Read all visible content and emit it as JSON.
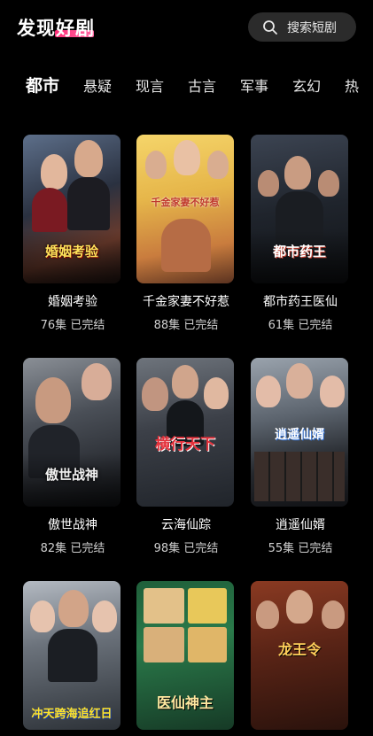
{
  "header": {
    "title": "发现好剧",
    "search_placeholder": "搜索短剧"
  },
  "tabs": [
    {
      "label": "都市",
      "active": true
    },
    {
      "label": "悬疑",
      "active": false
    },
    {
      "label": "现言",
      "active": false
    },
    {
      "label": "古言",
      "active": false
    },
    {
      "label": "军事",
      "active": false
    },
    {
      "label": "玄幻",
      "active": false
    },
    {
      "label": "热",
      "active": false
    }
  ],
  "dramas": [
    {
      "title": "婚姻考验",
      "episodes": "76集",
      "status": "已完结",
      "poster_text": "婚姻考验"
    },
    {
      "title": "千金家妻不好惹",
      "episodes": "88集",
      "status": "已完结",
      "poster_text": "千金家妻不好惹"
    },
    {
      "title": "都市药王医仙",
      "episodes": "61集",
      "status": "已完结",
      "poster_text": "都市药王"
    },
    {
      "title": "傲世战神",
      "episodes": "82集",
      "status": "已完结",
      "poster_text": "傲世战神"
    },
    {
      "title": "云海仙踪",
      "episodes": "98集",
      "status": "已完结",
      "poster_text": "横行天下"
    },
    {
      "title": "逍遥仙婿",
      "episodes": "55集",
      "status": "已完结",
      "poster_text": "逍遥仙婿"
    },
    {
      "poster_text": "冲天跨海追红日"
    },
    {
      "poster_text": "医仙神主"
    },
    {
      "poster_text": "龙王令"
    }
  ],
  "colors": {
    "accent": "#ff2d78",
    "background": "#000000",
    "search_bg": "#2b2b2b"
  }
}
